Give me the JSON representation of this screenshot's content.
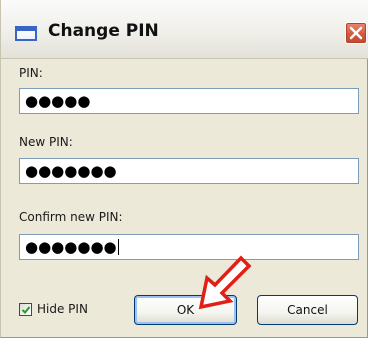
{
  "window": {
    "title": "Change PIN"
  },
  "fields": {
    "pin": {
      "label": "PIN:",
      "value": "●●●●●"
    },
    "new_pin": {
      "label": "New PIN:",
      "value": "●●●●●●●"
    },
    "confirm_pin": {
      "label": "Confirm new PIN:",
      "value": "●●●●●●●"
    }
  },
  "options": {
    "hide_pin": {
      "label": "Hide PIN",
      "checked": true
    }
  },
  "buttons": {
    "ok": "OK",
    "cancel": "Cancel"
  },
  "colors": {
    "arrow": "#e01f16",
    "close_button": "#d3593f",
    "window_background": "#ece9d8"
  },
  "icons": {
    "window": "window-icon",
    "close": "close-icon",
    "check": "checkmark-icon",
    "pointer": "red-arrow-icon"
  }
}
